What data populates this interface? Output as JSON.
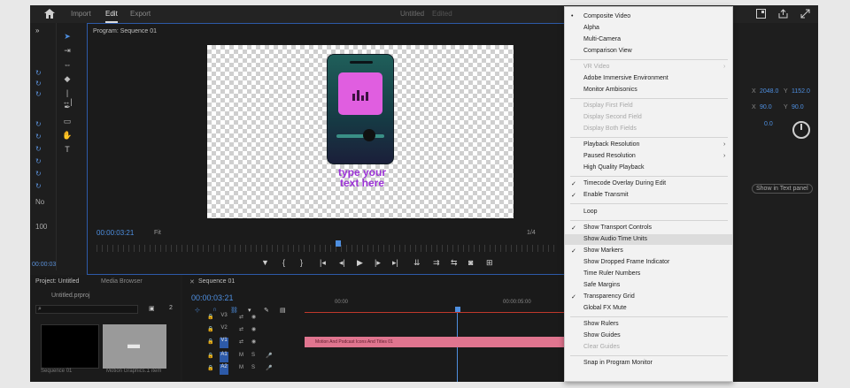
{
  "topbar": {
    "tabs": [
      "Import",
      "Edit",
      "Export"
    ],
    "title": "Untitled",
    "status": "Edited"
  },
  "program": {
    "title": "Program: Sequence 01",
    "timecode": "00:00:03:21",
    "fit": "Fit",
    "quality": "1/4"
  },
  "graphic": {
    "line1": "type your",
    "line2": "text here"
  },
  "right": {
    "x1_label": "X",
    "x1": "2048.0",
    "y1_label": "Y",
    "y1": "1152.0",
    "x2_label": "X",
    "x2": "90.0",
    "y2_label": "Y",
    "y2": "90.0",
    "rot": "0.0",
    "show_in_text_panel": "Show in Text panel"
  },
  "project": {
    "tabs": [
      "Project: Untitled",
      "Media Browser"
    ],
    "file": "Untitled.prproj",
    "count": "2",
    "thumb1_caption": "Sequence 01",
    "thumb2_caption": "Motion Graphics...",
    "thumb2_extra": "1 item"
  },
  "sequence": {
    "tab": "Sequence 01",
    "timecode": "00:00:03:21",
    "ruler": [
      "00:00",
      "00:00:05:00"
    ],
    "tracks": [
      "V3",
      "V2",
      "V1",
      "A1",
      "A2"
    ],
    "clip": "Motion And Podcast Icons And Titles 01"
  },
  "leftpanel": {
    "frame": "00:00:03",
    "bottom_label": "No",
    "zoom": "100"
  },
  "menu": {
    "items": [
      {
        "label": "Composite Video",
        "mark": "bullet"
      },
      {
        "label": "Alpha"
      },
      {
        "label": "Multi-Camera"
      },
      {
        "label": "Comparison View"
      },
      {
        "label": "VR Video",
        "disabled": true,
        "submenu": true
      },
      {
        "label": "Adobe Immersive Environment"
      },
      {
        "label": "Monitor Ambisonics"
      },
      {
        "label": "Display First Field",
        "disabled": true
      },
      {
        "label": "Display Second Field",
        "disabled": true
      },
      {
        "label": "Display Both Fields",
        "disabled": true
      },
      {
        "label": "Playback Resolution",
        "submenu": true
      },
      {
        "label": "Paused Resolution",
        "submenu": true
      },
      {
        "label": "High Quality Playback"
      },
      {
        "label": "Timecode Overlay During Edit",
        "mark": "check"
      },
      {
        "label": "Enable Transmit",
        "mark": "check"
      },
      {
        "label": "Loop"
      },
      {
        "label": "Show Transport Controls",
        "mark": "check"
      },
      {
        "label": "Show Audio Time Units",
        "highlight": true
      },
      {
        "label": "Show Markers",
        "mark": "check"
      },
      {
        "label": "Show Dropped Frame Indicator"
      },
      {
        "label": "Time Ruler Numbers"
      },
      {
        "label": "Safe Margins"
      },
      {
        "label": "Transparency Grid",
        "mark": "check"
      },
      {
        "label": "Global FX Mute"
      },
      {
        "label": "Show Rulers"
      },
      {
        "label": "Show Guides"
      },
      {
        "label": "Clear Guides",
        "disabled": true
      },
      {
        "label": "Snap in Program Monitor"
      }
    ]
  },
  "colors": {
    "accent": "#4e8fe0",
    "menu_bg": "#f2f2f2",
    "clip": "#e0758f",
    "screen_pink": "#e05ee0",
    "text_purple": "#9b32d6"
  }
}
